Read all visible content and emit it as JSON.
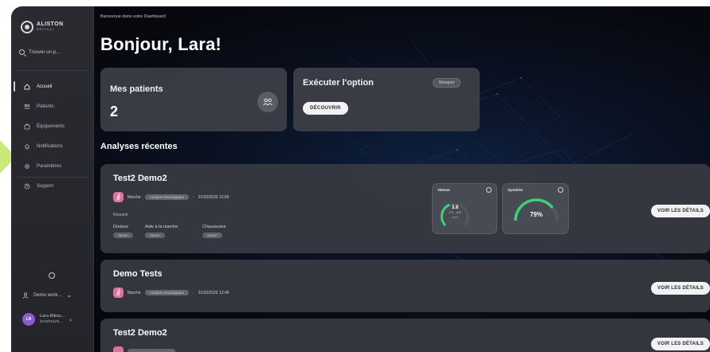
{
  "sidebar": {
    "logo_text": "ALISTON",
    "logo_sub": "MEDICAL",
    "search_placeholder": "Trouver un p...",
    "items": [
      {
        "label": "Accueil",
        "icon": "home-icon",
        "active": true
      },
      {
        "label": "Patients",
        "icon": "patients-icon",
        "active": false
      },
      {
        "label": "Équipements",
        "icon": "equipment-icon",
        "active": false
      },
      {
        "label": "Notifications",
        "icon": "bell-icon",
        "active": false
      },
      {
        "label": "Paramètres",
        "icon": "gear-icon",
        "active": false
      },
      {
        "label": "Support",
        "icon": "help-icon",
        "active": false
      }
    ],
    "workspace": "Demo work...",
    "user_initials": "LR",
    "user_name": "Lara Rikou...",
    "user_sub": "lerarkouni..."
  },
  "header": {
    "welcome": "Bienvenue dans votre Dashboard",
    "greeting": "Bonjour, Lara!"
  },
  "patients_card": {
    "title": "Mes patients",
    "count": "2"
  },
  "option_card": {
    "title": "Exécuter l'option",
    "hide_label": "Masquer",
    "discover_label": "DÉCOUVRIR"
  },
  "recent": {
    "title": "Analyses récentes",
    "items": [
      {
        "title": "Test2 Demo2",
        "type": "Marche",
        "tag": "Analyse neurologique",
        "date": "31/03/2026 12:55",
        "resume_label": "Résumé",
        "cols": [
          {
            "label": "Douleur",
            "value": "Aucun"
          },
          {
            "label": "Aide à la marche",
            "value": "Aucun"
          },
          {
            "label": "Chaussures",
            "value": "Aucun"
          }
        ],
        "speed": {
          "label": "Vitesse",
          "value": "3.8",
          "range": "2.7 - 6.6",
          "unit": "km/h"
        },
        "symmetry": {
          "label": "Symétrie",
          "value": "79%",
          "fraction": 0.79
        },
        "details_label": "VOIR LES DÉTAILS"
      },
      {
        "title": "Demo Tests",
        "type": "Marche",
        "tag": "Analyse neurologique",
        "date": "31/03/2026 12:46",
        "details_label": "VOIR LES DÉTAILS"
      },
      {
        "title": "Test2 Demo2",
        "details_label": "VOIR LES DÉTAILS"
      }
    ]
  },
  "colors": {
    "accent_green": "#3fd17a",
    "walk_icon_bg": "#d9739f",
    "avatar_bg": "#8a5bd0",
    "pointer_arrow": "#c9e97c"
  }
}
